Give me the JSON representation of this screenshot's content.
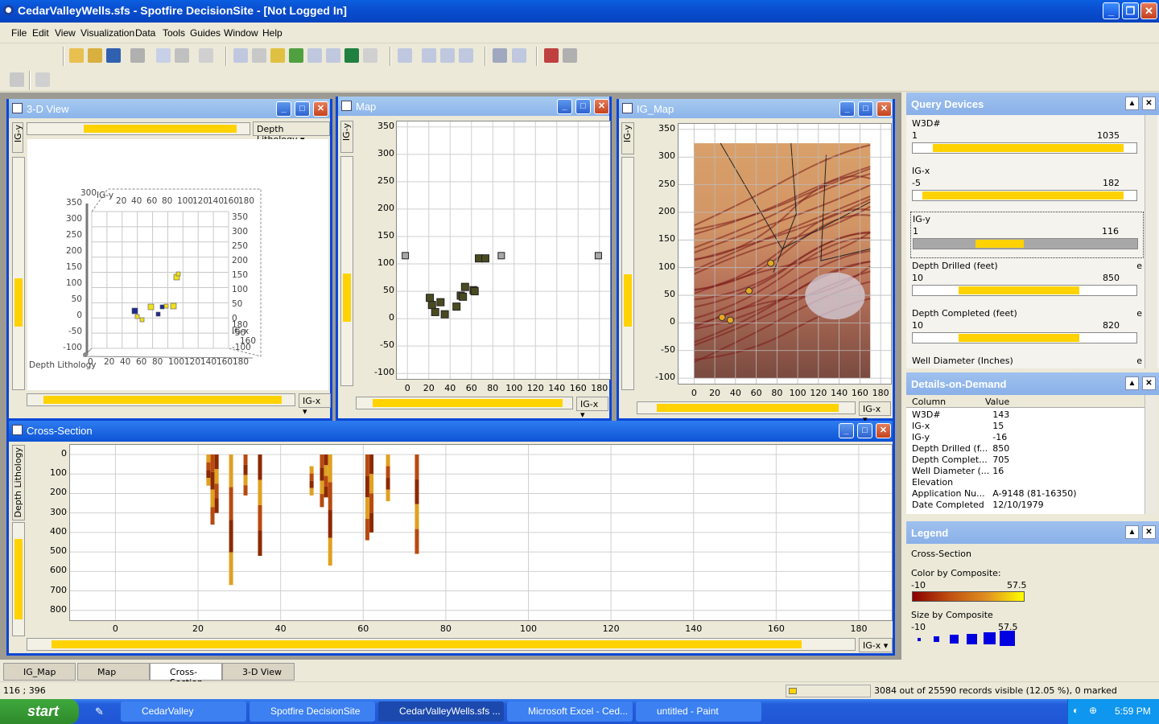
{
  "app": {
    "title": "CedarValleyWells.sfs - Spotfire DecisionSite - [Not Logged In]"
  },
  "menu": [
    "File",
    "Edit",
    "View",
    "Visualization",
    "Data",
    "Tools",
    "Guides",
    "Window",
    "Help"
  ],
  "windows": {
    "view3d": {
      "title": "3-D View",
      "color_by": "Depth Lithology",
      "x_axis": "IG-x",
      "y_axis": "IG-y",
      "z_label": "Depth Lithology",
      "x_ticks": [
        "0",
        "20",
        "40",
        "60",
        "80",
        "100",
        "120",
        "140",
        "160",
        "180"
      ],
      "top_ticks": [
        "20",
        "40",
        "60",
        "80",
        "100",
        "120",
        "140",
        "160",
        "180"
      ],
      "y_ticks": [
        "350",
        "300",
        "250",
        "200",
        "150",
        "100",
        "50",
        "0",
        "-50",
        "-100"
      ],
      "right_ticks": [
        "350",
        "300",
        "250",
        "200",
        "150",
        "100",
        "50",
        "0",
        "-50",
        "-100"
      ],
      "overlap_labels": [
        "300",
        "IG-y",
        "IG-x",
        "180",
        "160"
      ]
    },
    "map": {
      "title": "Map",
      "x_axis": "IG-x",
      "y_axis": "IG-y",
      "y_ticks": [
        "350",
        "300",
        "250",
        "200",
        "150",
        "100",
        "50",
        "0",
        "-50",
        "-100"
      ],
      "x_ticks": [
        "0",
        "20",
        "40",
        "60",
        "80",
        "100",
        "120",
        "140",
        "160",
        "180"
      ]
    },
    "igmap": {
      "title": "IG_Map",
      "x_axis": "IG-x",
      "y_axis": "IG-y",
      "y_ticks": [
        "350",
        "300",
        "250",
        "200",
        "150",
        "100",
        "50",
        "0",
        "-50",
        "-100"
      ],
      "x_ticks": [
        "0",
        "20",
        "40",
        "60",
        "80",
        "100",
        "120",
        "140",
        "160",
        "180"
      ]
    },
    "cross": {
      "title": "Cross-Section",
      "x_axis": "IG-x",
      "y_axis": "Depth Lithology",
      "y_ticks": [
        "0",
        "100",
        "200",
        "300",
        "400",
        "500",
        "600",
        "700",
        "800"
      ],
      "x_ticks": [
        "0",
        "20",
        "40",
        "60",
        "80",
        "100",
        "120",
        "140",
        "160",
        "180"
      ]
    }
  },
  "chart_data": [
    {
      "type": "scatter",
      "title": "Map",
      "xlabel": "IG-x",
      "ylabel": "IG-y",
      "xlim": [
        -10,
        190
      ],
      "ylim": [
        -110,
        360
      ],
      "points": [
        {
          "x": -2,
          "y": 115
        },
        {
          "x": 88,
          "y": 115
        },
        {
          "x": 179,
          "y": 115
        },
        {
          "x": 67,
          "y": 110
        },
        {
          "x": 73,
          "y": 110
        },
        {
          "x": 21,
          "y": 38
        },
        {
          "x": 23,
          "y": 25
        },
        {
          "x": 26,
          "y": 12
        },
        {
          "x": 31,
          "y": 30
        },
        {
          "x": 35,
          "y": 8
        },
        {
          "x": 46,
          "y": 22
        },
        {
          "x": 50,
          "y": 42
        },
        {
          "x": 52,
          "y": 40
        },
        {
          "x": 54,
          "y": 58
        },
        {
          "x": 62,
          "y": 52
        },
        {
          "x": 63,
          "y": 50
        }
      ]
    },
    {
      "type": "scatter",
      "title": "IG_Map",
      "xlabel": "IG-x",
      "ylabel": "IG-y",
      "xlim": [
        -15,
        190
      ],
      "ylim": [
        -110,
        360
      ],
      "points": [
        {
          "x": 27,
          "y": 10
        },
        {
          "x": 35,
          "y": 5
        },
        {
          "x": 53,
          "y": 58
        },
        {
          "x": 74,
          "y": 108
        }
      ]
    },
    {
      "type": "bar",
      "title": "Cross-Section",
      "xlabel": "IG-x",
      "ylabel": "Depth Lithology",
      "xlim": [
        -11,
        188
      ],
      "ylim": [
        0,
        900
      ],
      "wells": [
        {
          "x": 22.5,
          "top": 0,
          "bottom": 160
        },
        {
          "x": 23.5,
          "top": 0,
          "bottom": 360
        },
        {
          "x": 24.5,
          "top": 0,
          "bottom": 300
        },
        {
          "x": 28,
          "top": 0,
          "bottom": 670
        },
        {
          "x": 31.5,
          "top": 0,
          "bottom": 210
        },
        {
          "x": 35,
          "top": 0,
          "bottom": 520
        },
        {
          "x": 47.5,
          "top": 60,
          "bottom": 210
        },
        {
          "x": 50,
          "top": 0,
          "bottom": 270
        },
        {
          "x": 51,
          "top": 0,
          "bottom": 220
        },
        {
          "x": 52,
          "top": 0,
          "bottom": 570
        },
        {
          "x": 61,
          "top": 0,
          "bottom": 440
        },
        {
          "x": 62,
          "top": 0,
          "bottom": 400
        },
        {
          "x": 66,
          "top": 0,
          "bottom": 240
        },
        {
          "x": 73,
          "top": 0,
          "bottom": 510
        }
      ]
    }
  ],
  "query_devices": {
    "title": "Query Devices",
    "items": [
      {
        "name": "W3D#",
        "lo": "1",
        "hi": "1035",
        "e": "",
        "fill": [
          0.05,
          1.0
        ]
      },
      {
        "name": "IG-x",
        "lo": "-5",
        "hi": "182",
        "e": "",
        "fill": [
          0.0,
          1.0
        ]
      },
      {
        "name": "IG-y",
        "lo": "1",
        "hi": "116",
        "e": "",
        "fill": [
          0.26,
          0.5
        ]
      },
      {
        "name": "Depth Drilled (feet)",
        "lo": "10",
        "hi": "850",
        "e": "e",
        "fill": [
          0.18,
          0.78
        ]
      },
      {
        "name": "Depth Completed (feet)",
        "lo": "10",
        "hi": "820",
        "e": "e",
        "fill": [
          0.18,
          0.78
        ]
      },
      {
        "name": "Well Diameter (Inches)",
        "lo": "",
        "hi": "",
        "e": "e",
        "fill": [
          0,
          0
        ]
      }
    ]
  },
  "details": {
    "title": "Details-on-Demand",
    "header": {
      "col": "Column",
      "val": "Value"
    },
    "rows": [
      {
        "c": "W3D#",
        "v": "143"
      },
      {
        "c": "IG-x",
        "v": "15"
      },
      {
        "c": "IG-y",
        "v": "-16"
      },
      {
        "c": "Depth Drilled (f...",
        "v": "850"
      },
      {
        "c": "Depth Complet...",
        "v": "705"
      },
      {
        "c": "Well Diameter (...",
        "v": "16"
      },
      {
        "c": "Elevation",
        "v": ""
      },
      {
        "c": "Application Nu...",
        "v": "A-9148 (81-16350)"
      },
      {
        "c": "Date Completed",
        "v": "12/10/1979"
      }
    ]
  },
  "legend": {
    "title": "Legend",
    "viz": "Cross-Section",
    "color_label": "Color by Composite:",
    "color_min": "-10",
    "color_max": "57.5",
    "size_label": "Size by Composite",
    "size_min": "-10",
    "size_max": "57.5"
  },
  "tabs": [
    "IG_Map",
    "Map",
    "Cross-Section",
    "3-D View"
  ],
  "status": {
    "coords": "116 ; 396",
    "records": "3084 out of 25590 records visible (12.05 %), 0 marked"
  },
  "taskbar": {
    "start": "start",
    "tasks": [
      "CedarValley",
      "Spotfire DecisionSite",
      "CedarValleyWells.sfs ...",
      "Microsoft Excel - Ced...",
      "untitled - Paint"
    ],
    "clock": "5:59 PM"
  },
  "colors": {
    "accent": "#0a46d6",
    "slider": "#ffd200",
    "well_dark": "#8b2a00",
    "well_light": "#e0a020"
  }
}
